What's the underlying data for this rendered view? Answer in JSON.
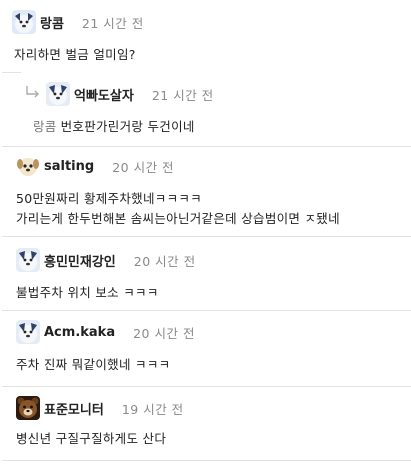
{
  "comments": [
    {
      "id": "c1",
      "author": "랑콤",
      "time": "21 시간 전",
      "avatar_icon": "dog-avatar-icon",
      "lines": [
        "자리하면 벌금 얼미임?"
      ]
    },
    {
      "id": "c2",
      "reply": true,
      "author": "억빠도살자",
      "time": "21 시간 전",
      "avatar_icon": "dog-avatar-icon",
      "mention": "랑콤",
      "lines": [
        "번호판가린거랑 두건이네"
      ]
    },
    {
      "id": "c3",
      "author": "salting",
      "time": "20 시간 전",
      "avatar_icon": "puppy-avatar-icon",
      "lines": [
        "50만원짜리 황제주차했네ㅋㅋㅋㅋ",
        "가리는게 한두번해본 솜씨는아닌거같은데 상습범이면 ㅈ됐네"
      ]
    },
    {
      "id": "c4",
      "author": "흥민민재강인",
      "time": "20 시간 전",
      "avatar_icon": "dog-avatar-icon",
      "lines": [
        "불법주차 위치 보소 ㅋㅋㅋ"
      ]
    },
    {
      "id": "c5",
      "author": "Acm.kaka",
      "time": "20 시간 전",
      "avatar_icon": "dog-avatar-icon",
      "lines": [
        "주차 진짜 뭐같이했네 ㅋㅋㅋ"
      ]
    },
    {
      "id": "c6",
      "author": "표준모니터",
      "time": "19 시간 전",
      "avatar_icon": "bear-avatar-icon",
      "lines": [
        "병신년 구질구질하게도 산다"
      ]
    }
  ]
}
